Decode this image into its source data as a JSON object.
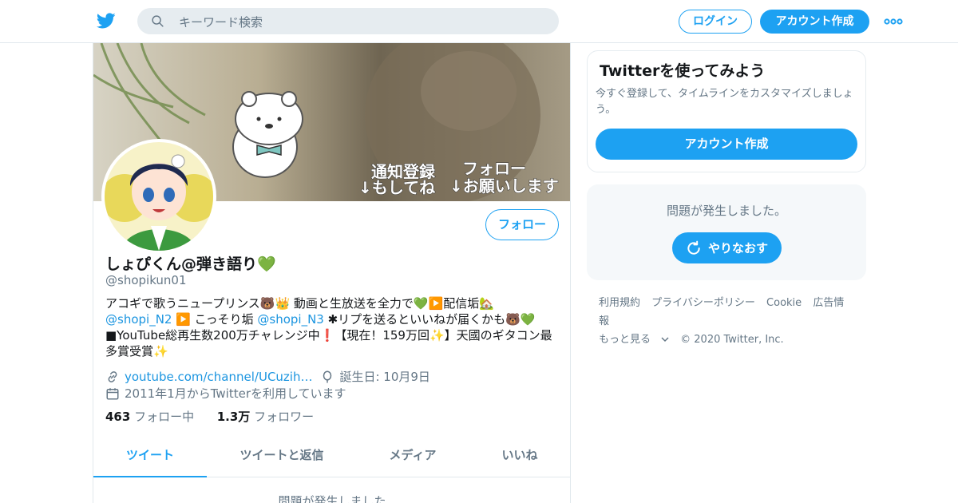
{
  "header": {
    "search_placeholder": "キーワード検索",
    "login_label": "ログイン",
    "signup_label": "アカウント作成"
  },
  "profile": {
    "name": "しょぴくん@弾き語り💚",
    "handle": "@shopikun01",
    "bio_line1": "アコギで歌うニュープリンス🐻👑 動画と生放送を全力で💚▶️配信垢🏡",
    "bio_link1": "@shopi_N2",
    "bio_mid1": " ▶️ こっそり垢 ",
    "bio_link2": "@shopi_N3",
    "bio_rest": " ✱リプを送るといいねが届くかも🐻💚 ■YouTube総再生数200万チャレンジ中❗【現在！159万回✨】天國のギタコン最多賞受賞✨",
    "website": "youtube.com/channel/UCuzih…",
    "birthday": "誕生日: 10月9日",
    "joined": "2011年1月からTwitterを利用しています",
    "following_count": "463",
    "following_label": "フォロー中",
    "followers_count": "1.3万",
    "followers_label": "フォロワー",
    "follow_button": "フォロー",
    "banner_text1": "通知登録",
    "banner_text2": "↓もしてね",
    "banner_text3": "フォロー",
    "banner_text4": "↓お願いします"
  },
  "tabs": [
    {
      "label": "ツイート"
    },
    {
      "label": "ツイートと返信"
    },
    {
      "label": "メディア"
    },
    {
      "label": "いいね"
    }
  ],
  "timeline_error": "問題が発生しました",
  "sidebar": {
    "card_title": "Twitterを使ってみよう",
    "card_text": "今すぐ登録して、タイムラインをカスタマイズしましょう。",
    "card_button": "アカウント作成",
    "error_message": "問題が発生しました。",
    "retry_label": "やりなおす"
  },
  "footer": {
    "links": [
      "利用規約",
      "プライバシーポリシー",
      "Cookie",
      "広告情報"
    ],
    "more": "もっと見る",
    "copyright": "© 2020 Twitter, Inc."
  },
  "colors": {
    "accent": "#1da1f2",
    "link": "#1b95e0",
    "muted": "#657786"
  }
}
